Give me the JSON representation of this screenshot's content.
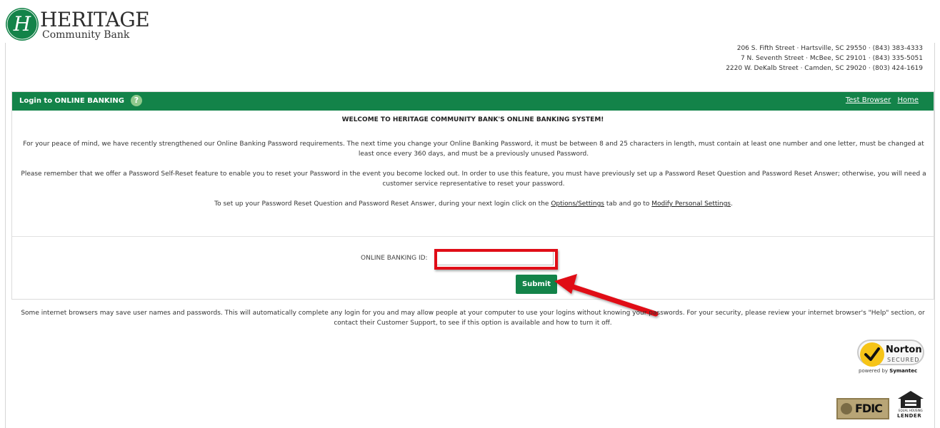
{
  "logo": {
    "name": "HERITAGE",
    "subtitle": "Community Bank",
    "mark_letter": "H"
  },
  "addresses": [
    "206 S. Fifth Street · Hartsville, SC 29550 · (843) 383-4333",
    "7 N. Seventh Street · McBee, SC 29101 · (843) 335-5051",
    "2220 W. DeKalb Street · Camden, SC 29020 · (803) 424-1619"
  ],
  "panel": {
    "title": "Login to ONLINE BANKING",
    "help_icon_glyph": "?",
    "links": {
      "test_browser": "Test Browser",
      "home": "Home"
    },
    "welcome": "WELCOME TO HERITAGE COMMUNITY BANK'S ONLINE BANKING SYSTEM!",
    "paragraph1": "For your peace of mind, we have recently strengthened our Online Banking Password requirements. The next time you change your Online Banking Password, it must be between 8 and 25 characters in length, must contain at least one number and one letter, must be changed at least once every 360 days, and must be a previously unused Password.",
    "paragraph2": "Please remember that we offer a Password Self-Reset feature to enable you to reset your Password in the event you become locked out. In order to use this feature, you must have previously set up a Password Reset Question and Password Reset Answer; otherwise, you will need a customer service representative to reset your password.",
    "paragraph3": {
      "prefix": "To set up your Password Reset Question and Password Reset Answer, during your next login click on the",
      "link1": "Options/Settings",
      "middle": "tab and go to",
      "link2": "Modify Personal Settings",
      "suffix": "."
    },
    "login": {
      "id_label": "ONLINE BANKING ID:",
      "id_value": "",
      "submit_label": "Submit"
    }
  },
  "security_note": "Some internet browsers may save user names and passwords. This will automatically complete any login for you and may allow people at your computer to use your logins without knowing your passwords. For your security, please review your internet browser's \"Help\" section, or contact their Customer Support, to see if this option is available and how to turn it off.",
  "badges": {
    "norton_word": "Norton",
    "norton_secured": "SECURED",
    "norton_powered_prefix": "powered by",
    "norton_powered_brand": "Symantec",
    "fdic": "FDIC",
    "ehl_small": "EQUAL HOUSING",
    "ehl_lender": "LENDER"
  },
  "colors": {
    "brand_green": "#138349",
    "annotation_red": "#e00d17",
    "help_icon": "#8ec98c"
  }
}
